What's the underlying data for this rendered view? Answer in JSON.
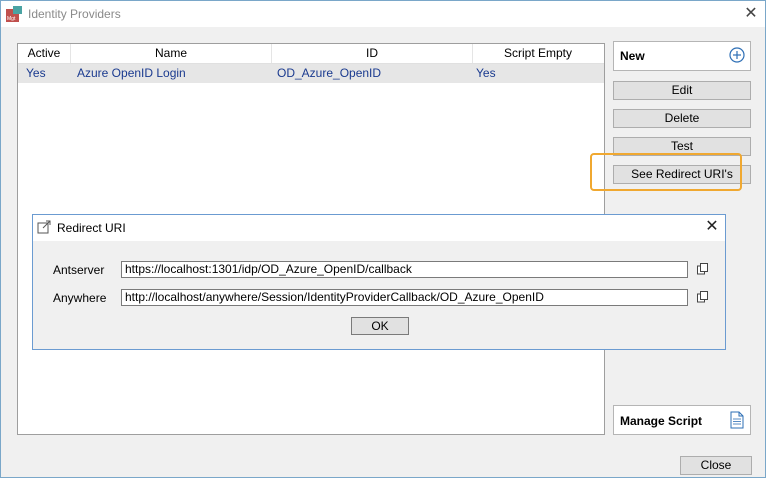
{
  "window": {
    "title": "Identity Providers",
    "close_glyph": "✕"
  },
  "grid": {
    "columns": [
      "Active",
      "Name",
      "ID",
      "Script Empty"
    ],
    "rows": [
      {
        "active": "Yes",
        "name": "Azure OpenID Login",
        "id": "OD_Azure_OpenID",
        "script_empty": "Yes"
      }
    ]
  },
  "side_buttons": {
    "new": "New",
    "edit": "Edit",
    "delete": "Delete",
    "test": "Test",
    "see_redirect": "See Redirect URI's",
    "manage_script": "Manage Script",
    "close": "Close"
  },
  "dialog": {
    "title": "Redirect URI",
    "close_glyph": "✕",
    "rows": [
      {
        "label": "Antserver",
        "value": "https://localhost:1301/idp/OD_Azure_OpenID/callback"
      },
      {
        "label": "Anywhere",
        "value": "http://localhost/anywhere/Session/IdentityProviderCallback/OD_Azure_OpenID"
      }
    ],
    "ok": "OK"
  },
  "colors": {
    "highlight": "#f0a830",
    "row_text": "#1a3a8f",
    "row_bg": "#e6e6e6"
  }
}
